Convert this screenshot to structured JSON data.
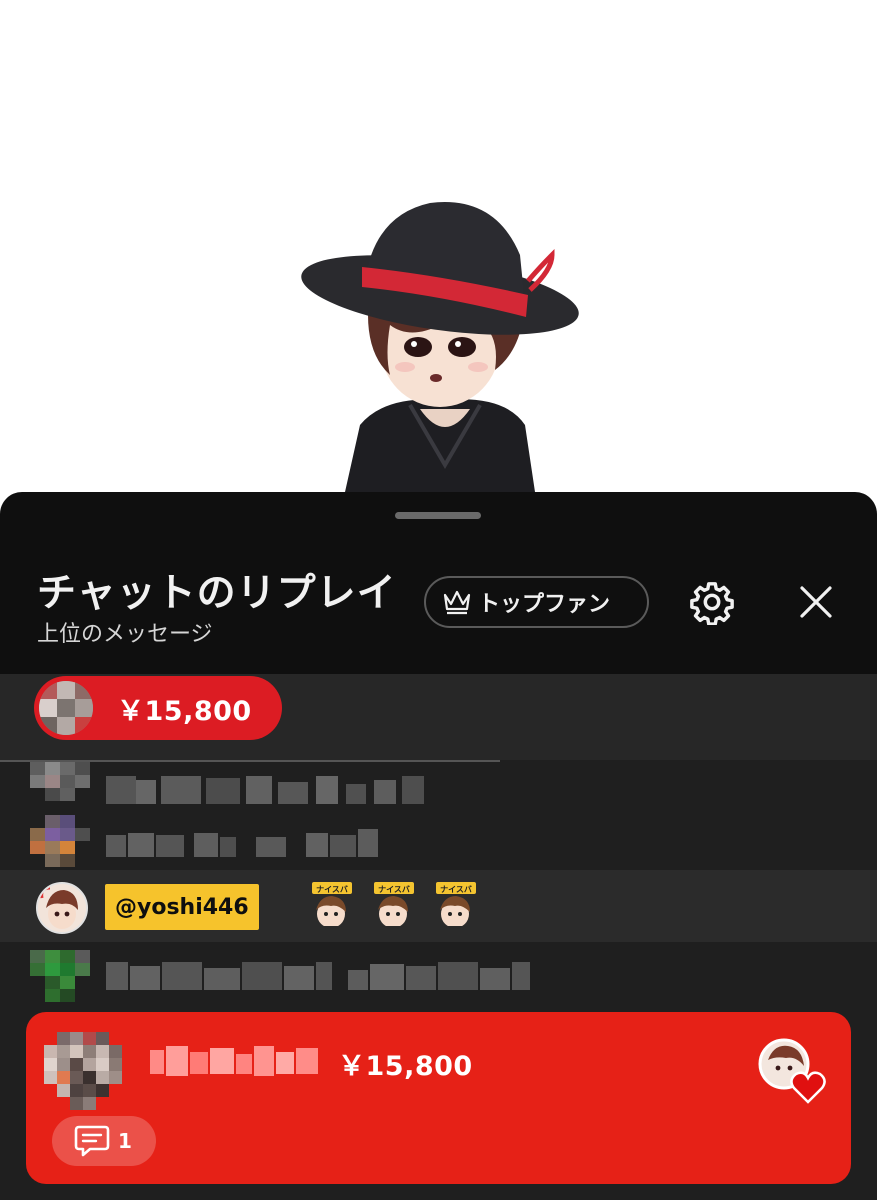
{
  "header": {
    "title": "チャットのリプレイ",
    "subtitle": "上位のメッセージ",
    "top_fan_label": "トップファン",
    "icons": {
      "top_fan": "crown-icon",
      "settings": "gear-icon",
      "close": "close-icon"
    }
  },
  "ticker": {
    "amount": "￥15,800"
  },
  "chat": {
    "mention": {
      "handle": "@yoshi446",
      "stickers": [
        "ナイスバ",
        "ナイスバ",
        "ナイスバ"
      ]
    }
  },
  "superchat": {
    "amount": "￥15,800",
    "reply_count": "1",
    "icons": {
      "reply": "comment-icon",
      "heart": "heart-icon"
    }
  },
  "colors": {
    "panel_bg": "#0f0f0f",
    "superchat_red": "#e62117",
    "ticker_red": "#dc1c23",
    "mention_yellow": "#f6c32c"
  }
}
